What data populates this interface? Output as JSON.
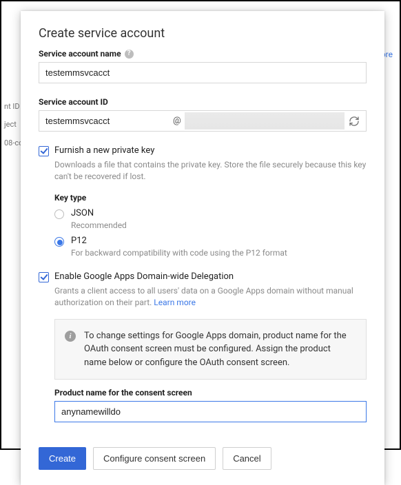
{
  "bg": {
    "more": "more",
    "l1": "nt ID",
    "l2": "ject",
    "l3": "08-co"
  },
  "dialog": {
    "title": "Create service account",
    "name": {
      "label": "Service account name",
      "value": "testemmsvcacct"
    },
    "id": {
      "label": "Service account ID",
      "value": "testemmsvcacct",
      "at": "@"
    },
    "furnish": {
      "label": "Furnish a new private key",
      "help": "Downloads a file that contains the private key. Store the file securely because this key can't be recovered if lost.",
      "keytype_label": "Key type",
      "json": {
        "label": "JSON",
        "help": "Recommended"
      },
      "p12": {
        "label": "P12",
        "help": "For backward compatibility with code using the P12 format"
      }
    },
    "delegation": {
      "label": "Enable Google Apps Domain-wide Delegation",
      "help": "Grants a client access to all users' data on a Google Apps domain without manual authorization on their part. ",
      "learn_more": "Learn more",
      "info": "To change settings for Google Apps domain, product name for the OAuth consent screen must be configured. Assign the product name below or configure the OAuth consent screen.",
      "consent_label": "Product name for the consent screen",
      "consent_value": "anynamewilldo"
    },
    "buttons": {
      "create": "Create",
      "configure": "Configure consent screen",
      "cancel": "Cancel"
    }
  }
}
